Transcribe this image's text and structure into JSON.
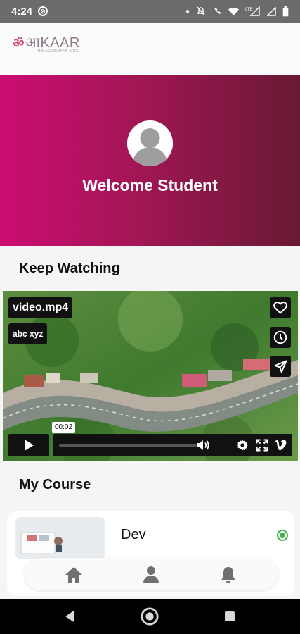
{
  "status_bar": {
    "time": "4:24",
    "left_icon": "screen-record-icon",
    "right_icons": [
      "dot-icon",
      "muted-icon",
      "wifi-call-icon",
      "wifi-icon",
      "lte-signal-icon",
      "signal-icon",
      "battery-icon"
    ],
    "network_label": "LTE"
  },
  "header": {
    "logo_mark": "ॐ",
    "logo_text": "आKAAR",
    "logo_subtext": "THE ACADEMY OF ARTS"
  },
  "hero": {
    "welcome_text": "Welcome Student",
    "gradient_colors": [
      "#cc0d73",
      "#681934"
    ]
  },
  "keep_watching": {
    "title": "Keep Watching",
    "video": {
      "file_name": "video.mp4",
      "subtitle": "abc xyz",
      "time": "00:02",
      "progress": 0.01,
      "side_actions": [
        "heart-icon",
        "clock-icon",
        "send-icon"
      ],
      "controls": [
        "play-icon",
        "volume-icon",
        "settings-icon",
        "fullscreen-icon",
        "vimeo-icon"
      ]
    }
  },
  "my_course": {
    "title": "My Course",
    "courses": [
      {
        "name": "Dev",
        "status_color": "#43b04c"
      }
    ]
  },
  "bottom_nav": {
    "items": [
      "home-icon",
      "profile-icon",
      "notifications-icon"
    ]
  },
  "android_nav": [
    "back-icon",
    "home-circle-icon",
    "recents-icon"
  ]
}
